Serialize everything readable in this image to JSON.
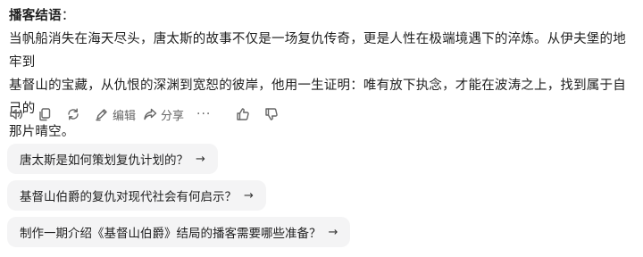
{
  "answer": {
    "heading": "播客结语",
    "colon": "：",
    "lines": [
      "当帆船消失在海天尽头，唐太斯的故事不仅是一场复仇传奇，更是人性在极端境遇下的淬炼。从伊夫堡的地牢到",
      "基督山的宝藏，从仇恨的深渊到宽恕的彼岸，他用一生证明：唯有放下执念，才能在波涛之上，找到属于自己的",
      "那片晴空。"
    ]
  },
  "toolbar": {
    "edit_label": "编辑",
    "share_label": "分享",
    "more_label": "···"
  },
  "suggestions": [
    {
      "text": "唐太斯是如何策划复仇计划的？",
      "arrow": "→"
    },
    {
      "text": "基督山伯爵的复仇对现代社会有何启示？",
      "arrow": "→"
    },
    {
      "text": "制作一期介绍《基督山伯爵》结局的播客需要哪些准备？",
      "arrow": "→"
    }
  ]
}
